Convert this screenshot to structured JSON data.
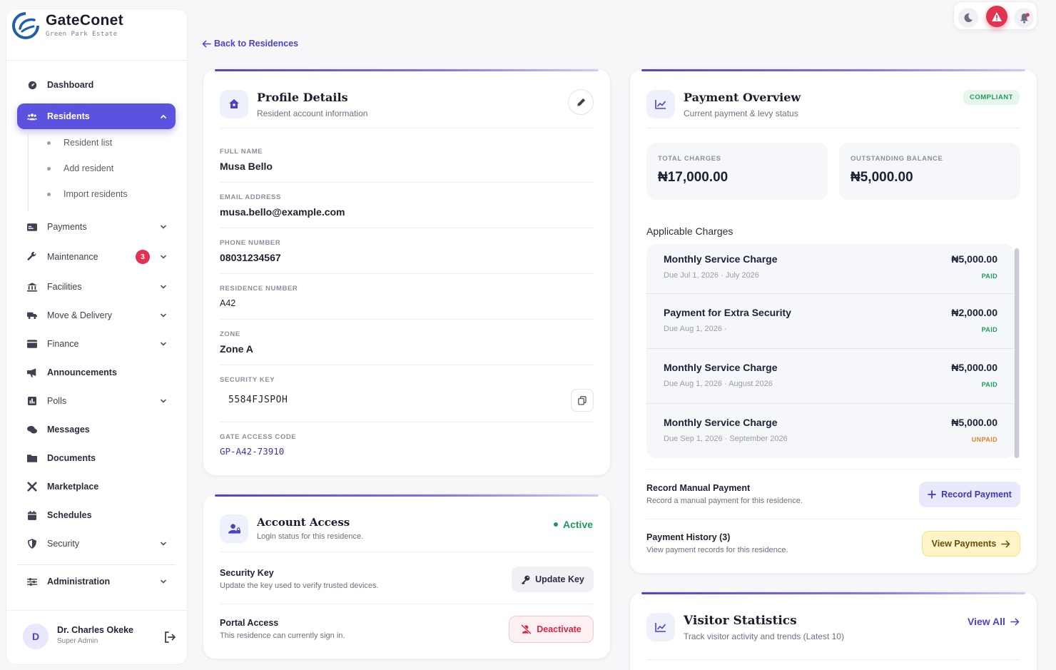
{
  "brand": {
    "name": "GateConet",
    "estate": "Green Park Estate"
  },
  "sidebar": {
    "items": [
      {
        "label": "Dashboard",
        "icon": "dashboard-icon"
      },
      {
        "label": "Residents",
        "icon": "users-icon",
        "active": true
      },
      {
        "label": "Payments",
        "icon": "payments-icon"
      },
      {
        "label": "Maintenance",
        "icon": "wrench-icon",
        "badge": "3"
      },
      {
        "label": "Facilities",
        "icon": "building-icon"
      },
      {
        "label": "Move & Delivery",
        "icon": "truck-icon"
      },
      {
        "label": "Finance",
        "icon": "wallet-icon"
      },
      {
        "label": "Announcements",
        "icon": "megaphone-icon"
      },
      {
        "label": "Polls",
        "icon": "poll-icon"
      },
      {
        "label": "Messages",
        "icon": "messages-icon"
      },
      {
        "label": "Documents",
        "icon": "folder-icon"
      },
      {
        "label": "Marketplace",
        "icon": "tools-icon"
      },
      {
        "label": "Schedules",
        "icon": "calendar-icon"
      },
      {
        "label": "Security",
        "icon": "shield-icon"
      },
      {
        "label": "Administration",
        "icon": "sliders-icon"
      }
    ],
    "sub_items": [
      "Resident list",
      "Add resident",
      "Import residents"
    ],
    "user": {
      "initial": "D",
      "name": "Dr. Charles Okeke",
      "role": "Super Admin"
    }
  },
  "nav": {
    "back": "Back to Residences"
  },
  "profile": {
    "title": "Profile Details",
    "subtitle": "Resident account information",
    "fields": {
      "full_name": {
        "label": "FULL NAME",
        "value": "Musa Bello"
      },
      "email": {
        "label": "EMAIL ADDRESS",
        "value": "musa.bello@example.com"
      },
      "phone": {
        "label": "PHONE NUMBER",
        "value": "08031234567"
      },
      "residence": {
        "label": "RESIDENCE NUMBER",
        "value": "A42"
      },
      "zone": {
        "label": "ZONE",
        "value": "Zone A"
      },
      "security_key": {
        "label": "SECURITY KEY",
        "value": "5584FJSPOH"
      },
      "gate_code": {
        "label": "GATE ACCESS CODE",
        "value": "GP-A42-73910"
      }
    }
  },
  "access": {
    "title": "Account Access",
    "subtitle": "Login status for this residence.",
    "status": "Active",
    "security_key": {
      "title": "Security Key",
      "desc": "Update the key used to verify trusted devices.",
      "button": "Update Key"
    },
    "portal": {
      "title": "Portal Access",
      "desc": "This residence can currently sign in.",
      "button": "Deactivate"
    }
  },
  "payment": {
    "title": "Payment Overview",
    "subtitle": "Current payment & levy status",
    "status": "COMPLIANT",
    "total_label": "TOTAL CHARGES",
    "total_value": "₦17,000.00",
    "outstanding_label": "OUTSTANDING BALANCE",
    "outstanding_value": "₦5,000.00",
    "charges_heading": "Applicable Charges",
    "charges": [
      {
        "title": "Monthly Service Charge",
        "due": "Due Jul 1, 2026 · July 2026",
        "amount": "₦5,000.00",
        "status": "PAID"
      },
      {
        "title": "Payment for Extra Security",
        "due": "Due Aug 1, 2026 ·",
        "amount": "₦2,000.00",
        "status": "PAID"
      },
      {
        "title": "Monthly Service Charge",
        "due": "Due Aug 1, 2026 · August 2026",
        "amount": "₦5,000.00",
        "status": "PAID"
      },
      {
        "title": "Monthly Service Charge",
        "due": "Due Sep 1, 2026 · September 2026",
        "amount": "₦5,000.00",
        "status": "UNPAID"
      }
    ],
    "manual": {
      "title": "Record Manual Payment",
      "desc": "Record a manual payment for this residence.",
      "button": "Record Payment"
    },
    "history": {
      "title": "Payment History (3)",
      "desc": "View payment records for this residence.",
      "button": "View Payments"
    }
  },
  "visitors": {
    "title": "Visitor Statistics",
    "subtitle": "Track visitor activity and trends (Latest 10)",
    "link": "View All"
  },
  "colors": {
    "accent": "#5b52e0",
    "paid": "#1f9a5a",
    "unpaid": "#d9822b",
    "danger": "#e0334f"
  }
}
